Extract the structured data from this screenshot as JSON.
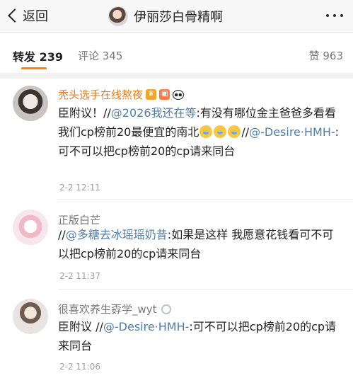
{
  "header": {
    "back_label": "返回",
    "title": "伊丽莎白骨精啊",
    "more_icon": "more-dots-icon"
  },
  "tabs": {
    "repost": "转发 239",
    "comment": "评论 345",
    "like": "赞 963",
    "accent_color": "#ff8200"
  },
  "comments": [
    {
      "username": "秃头选手在线熬夜",
      "badges": [
        "vip-crown-icon",
        "fan-badge-icon",
        "panda-emoji-icon"
      ],
      "prefix": "臣附议！//",
      "mention1": "@2026我还在等",
      "text1": ":有没有哪位金主爸爸多看看我们cp榜前20最便宜的南北",
      "text2": "//",
      "mention2": "@-Desire·HMH-",
      "text3": ":可不可以把cp榜前20的cp请来同台",
      "time": "2-2 12:11"
    },
    {
      "username": "正版白芒",
      "prefix": "//",
      "mention1": "@多糖去冰瑶瑶奶昔",
      "text1": ":如果是这样 我愿意花钱看可不可以把cp榜前20的cp请来同台",
      "time": "2-2 11:37"
    },
    {
      "username": "很喜欢养生孬学_wyt",
      "badges": [
        "ring-icon"
      ],
      "prefix": "臣附议 //",
      "mention1": "@-Desire·HMH-",
      "text1": ":可不可以把cp榜前20的cp请来同台",
      "time": "2-2 11:06"
    }
  ]
}
